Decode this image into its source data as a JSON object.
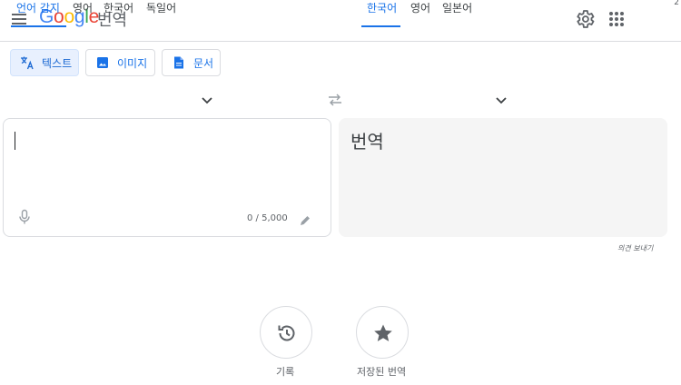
{
  "header": {
    "logo_letters": [
      {
        "ch": "G",
        "color": "#4285F4"
      },
      {
        "ch": "o",
        "color": "#EA4335"
      },
      {
        "ch": "o",
        "color": "#FBBC05"
      },
      {
        "ch": "g",
        "color": "#4285F4"
      },
      {
        "ch": "l",
        "color": "#34A853"
      },
      {
        "ch": "e",
        "color": "#EA4335"
      }
    ],
    "product": "번역",
    "edge_mark": "2"
  },
  "modes": {
    "text": "텍스트",
    "image": "이미지",
    "document": "문서"
  },
  "source_langs": [
    "언어 감지",
    "영어",
    "한국어",
    "독일어"
  ],
  "target_langs": [
    "한국어",
    "영어",
    "일본어"
  ],
  "source": {
    "value": "",
    "counter": "0 / 5,000"
  },
  "target": {
    "placeholder": "번역"
  },
  "feedback": "의견 보내기",
  "history": {
    "label": "기록"
  },
  "saved": {
    "label": "저장된 번역"
  },
  "colors": {
    "accent": "#1a73e8",
    "active_bg": "#e8f0fe",
    "border": "#dadce0",
    "panel_bg": "#f5f5f5"
  }
}
